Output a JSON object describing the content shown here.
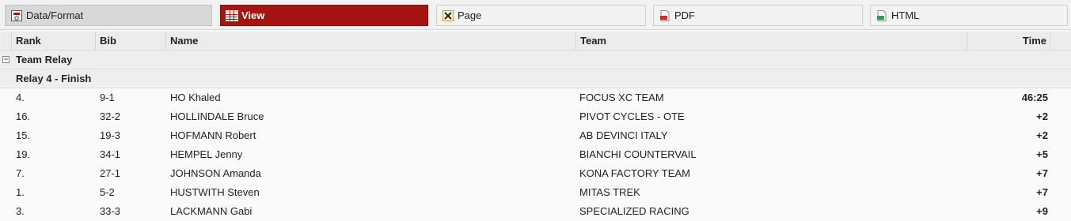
{
  "toolbar": {
    "tabs": [
      {
        "label": "Data/Format",
        "icon": "data-format-icon"
      },
      {
        "label": "View",
        "icon": "table-view-icon"
      },
      {
        "label": "Page",
        "icon": "page-setup-icon"
      },
      {
        "label": "PDF",
        "icon": "pdf-file-icon"
      },
      {
        "label": "HTML",
        "icon": "html-file-icon"
      }
    ],
    "active_tab": "View",
    "accent_color": "#a5140f"
  },
  "table": {
    "columns": {
      "rank": "Rank",
      "bib": "Bib",
      "name": "Name",
      "team": "Team",
      "time": "Time"
    },
    "group": {
      "label": "Team Relay",
      "expander": "⊟"
    },
    "subgroup": {
      "label": "Relay 4 - Finish"
    },
    "rows": [
      {
        "rank": "4.",
        "bib": "9-1",
        "name": "HO Khaled",
        "team": "FOCUS XC TEAM",
        "time": "46:25"
      },
      {
        "rank": "16.",
        "bib": "32-2",
        "name": "HOLLINDALE Bruce",
        "team": "PIVOT CYCLES - OTE",
        "time": "+2"
      },
      {
        "rank": "15.",
        "bib": "19-3",
        "name": "HOFMANN Robert",
        "team": "AB DEVINCI ITALY",
        "time": "+2"
      },
      {
        "rank": "19.",
        "bib": "34-1",
        "name": "HEMPEL Jenny",
        "team": "BIANCHI COUNTERVAIL",
        "time": "+5"
      },
      {
        "rank": "7.",
        "bib": "27-1",
        "name": "JOHNSON Amanda",
        "team": "KONA FACTORY TEAM",
        "time": "+7"
      },
      {
        "rank": "1.",
        "bib": "5-2",
        "name": "HUSTWITH Steven",
        "team": "MITAS TREK",
        "time": "+7"
      },
      {
        "rank": "3.",
        "bib": "33-3",
        "name": "LACKMANN Gabi",
        "team": "SPECIALIZED RACING",
        "time": "+9"
      }
    ]
  }
}
